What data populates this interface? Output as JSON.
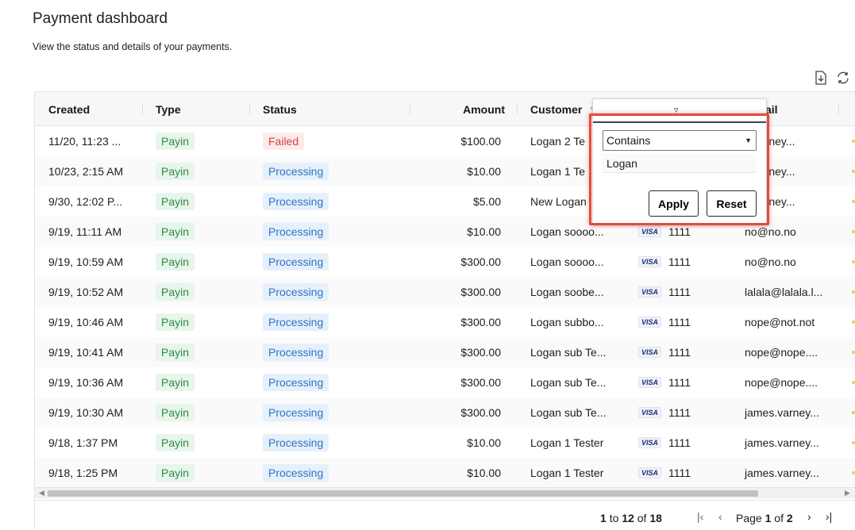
{
  "page": {
    "title": "Payment dashboard",
    "subtitle": "View the status and details of your payments."
  },
  "toolbar": {
    "export_icon": "download-icon",
    "refresh_icon": "refresh-icon"
  },
  "table": {
    "columns": [
      {
        "label": "Created"
      },
      {
        "label": "Type"
      },
      {
        "label": "Status"
      },
      {
        "label": "Amount"
      },
      {
        "label": "Customer"
      },
      {
        "label": "ail"
      }
    ],
    "rows": [
      {
        "created": "11/20, 11:23 ...",
        "type": "Payin",
        "status": "Failed",
        "status_kind": "failed",
        "amount": "$100.00",
        "customer": "Logan 2 Te",
        "card": "",
        "email": "s.varney..."
      },
      {
        "created": "10/23, 2:15 AM",
        "type": "Payin",
        "status": "Processing",
        "status_kind": "processing",
        "amount": "$10.00",
        "customer": "Logan 1 Te",
        "card": "",
        "email": "s.varney..."
      },
      {
        "created": "9/30, 12:02 P...",
        "type": "Payin",
        "status": "Processing",
        "status_kind": "processing",
        "amount": "$5.00",
        "customer": "New Logan",
        "card": "",
        "email": "s.varney..."
      },
      {
        "created": "9/19, 11:11 AM",
        "type": "Payin",
        "status": "Processing",
        "status_kind": "processing",
        "amount": "$10.00",
        "customer": "Logan soooo...",
        "card": "1111",
        "email": "no@no.no"
      },
      {
        "created": "9/19, 10:59 AM",
        "type": "Payin",
        "status": "Processing",
        "status_kind": "processing",
        "amount": "$300.00",
        "customer": "Logan soooo...",
        "card": "1111",
        "email": "no@no.no"
      },
      {
        "created": "9/19, 10:52 AM",
        "type": "Payin",
        "status": "Processing",
        "status_kind": "processing",
        "amount": "$300.00",
        "customer": "Logan soobe...",
        "card": "1111",
        "email": "lalala@lalala.l..."
      },
      {
        "created": "9/19, 10:46 AM",
        "type": "Payin",
        "status": "Processing",
        "status_kind": "processing",
        "amount": "$300.00",
        "customer": "Logan subbo...",
        "card": "1111",
        "email": "nope@not.not"
      },
      {
        "created": "9/19, 10:41 AM",
        "type": "Payin",
        "status": "Processing",
        "status_kind": "processing",
        "amount": "$300.00",
        "customer": "Logan sub Te...",
        "card": "1111",
        "email": "nope@nope...."
      },
      {
        "created": "9/19, 10:36 AM",
        "type": "Payin",
        "status": "Processing",
        "status_kind": "processing",
        "amount": "$300.00",
        "customer": "Logan sub Te...",
        "card": "1111",
        "email": "nope@nope...."
      },
      {
        "created": "9/19, 10:30 AM",
        "type": "Payin",
        "status": "Processing",
        "status_kind": "processing",
        "amount": "$300.00",
        "customer": "Logan sub Te...",
        "card": "1111",
        "email": "james.varney..."
      },
      {
        "created": "9/18, 1:37 PM",
        "type": "Payin",
        "status": "Processing",
        "status_kind": "processing",
        "amount": "$10.00",
        "customer": "Logan 1 Tester",
        "card": "1111",
        "email": "james.varney..."
      },
      {
        "created": "9/18, 1:25 PM",
        "type": "Payin",
        "status": "Processing",
        "status_kind": "processing",
        "amount": "$10.00",
        "customer": "Logan 1 Tester",
        "card": "1111",
        "email": "james.varney..."
      }
    ],
    "card_brand": "VISA"
  },
  "filter": {
    "operator": "Contains",
    "value": "Logan",
    "apply_label": "Apply",
    "reset_label": "Reset"
  },
  "pagination": {
    "range_start": "1",
    "range_to": "to",
    "range_end": "12",
    "range_of": "of",
    "total": "18",
    "page_label": "Page",
    "current_page": "1",
    "page_of": "of",
    "total_pages": "2"
  },
  "colors": {
    "highlight": "#e14c3d",
    "payin_green": "#2f8a43",
    "processing_blue": "#2f74c4",
    "failed_red": "#d0453f"
  }
}
